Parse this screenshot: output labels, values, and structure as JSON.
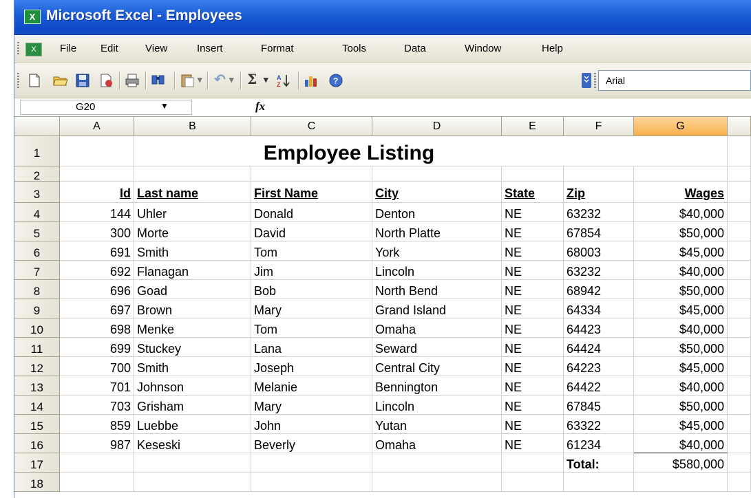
{
  "window": {
    "title": "Microsoft Excel - Employees",
    "app_icon": "excel-icon"
  },
  "menu": {
    "items": [
      "File",
      "Edit",
      "View",
      "Insert",
      "Format",
      "Tools",
      "Data",
      "Window",
      "Help"
    ]
  },
  "toolbar": {
    "buttons": [
      "new-icon",
      "open-icon",
      "save-icon",
      "permission-icon",
      "print-icon",
      "research-icon",
      "paste-icon",
      "undo-icon",
      "autosum-icon",
      "sort-ascending-icon",
      "chart-wizard-icon",
      "help-icon",
      "toolbar-options-icon"
    ],
    "font_name": "Arial"
  },
  "formula_bar": {
    "name_box": "G20",
    "fx_label": "fx",
    "formula": ""
  },
  "sheet": {
    "column_headers": [
      "A",
      "B",
      "C",
      "D",
      "E",
      "F",
      "G"
    ],
    "selected_column": "G",
    "title": "Employee Listing",
    "headers": {
      "id": "Id",
      "last": "Last name",
      "first": "First Name",
      "city": "City",
      "state": "State",
      "zip": "Zip",
      "wages": "Wages"
    },
    "rows": [
      {
        "id": "144",
        "last": "Uhler",
        "first": "Donald",
        "city": "Denton",
        "state": "NE",
        "zip": "63232",
        "wages": "$40,000"
      },
      {
        "id": "300",
        "last": "Morte",
        "first": "David",
        "city": "North Platte",
        "state": "NE",
        "zip": "67854",
        "wages": "$50,000"
      },
      {
        "id": "691",
        "last": "Smith",
        "first": "Tom",
        "city": "York",
        "state": "NE",
        "zip": "68003",
        "wages": "$45,000"
      },
      {
        "id": "692",
        "last": "Flanagan",
        "first": "Jim",
        "city": "Lincoln",
        "state": "NE",
        "zip": "63232",
        "wages": "$40,000"
      },
      {
        "id": "696",
        "last": "Goad",
        "first": "Bob",
        "city": "North Bend",
        "state": "NE",
        "zip": "68942",
        "wages": "$50,000"
      },
      {
        "id": "697",
        "last": "Brown",
        "first": "Mary",
        "city": "Grand Island",
        "state": "NE",
        "zip": "64334",
        "wages": "$45,000"
      },
      {
        "id": "698",
        "last": "Menke",
        "first": "Tom",
        "city": "Omaha",
        "state": "NE",
        "zip": "64423",
        "wages": "$40,000"
      },
      {
        "id": "699",
        "last": "Stuckey",
        "first": "Lana",
        "city": "Seward",
        "state": "NE",
        "zip": "64424",
        "wages": "$50,000"
      },
      {
        "id": "700",
        "last": "Smith",
        "first": "Joseph",
        "city": "Central City",
        "state": "NE",
        "zip": "64223",
        "wages": "$45,000"
      },
      {
        "id": "701",
        "last": "Johnson",
        "first": "Melanie",
        "city": "Bennington",
        "state": "NE",
        "zip": "64422",
        "wages": "$40,000"
      },
      {
        "id": "703",
        "last": "Grisham",
        "first": "Mary",
        "city": "Lincoln",
        "state": "NE",
        "zip": "67845",
        "wages": "$50,000"
      },
      {
        "id": "859",
        "last": "Luebbe",
        "first": "John",
        "city": "Yutan",
        "state": "NE",
        "zip": "63322",
        "wages": "$45,000"
      },
      {
        "id": "987",
        "last": "Keseski",
        "first": "Beverly",
        "city": "Omaha",
        "state": "NE",
        "zip": "61234",
        "wages": "$40,000"
      }
    ],
    "total_label": "Total:",
    "total_value": "$580,000",
    "row_numbers": [
      "1",
      "2",
      "3",
      "4",
      "5",
      "6",
      "7",
      "8",
      "9",
      "10",
      "11",
      "12",
      "13",
      "14",
      "15",
      "16",
      "17",
      "18"
    ]
  },
  "colors": {
    "titlebar": "#0d49c7",
    "selected_column_header": "#f6b14e",
    "excel_green": "#1f8f3a"
  }
}
